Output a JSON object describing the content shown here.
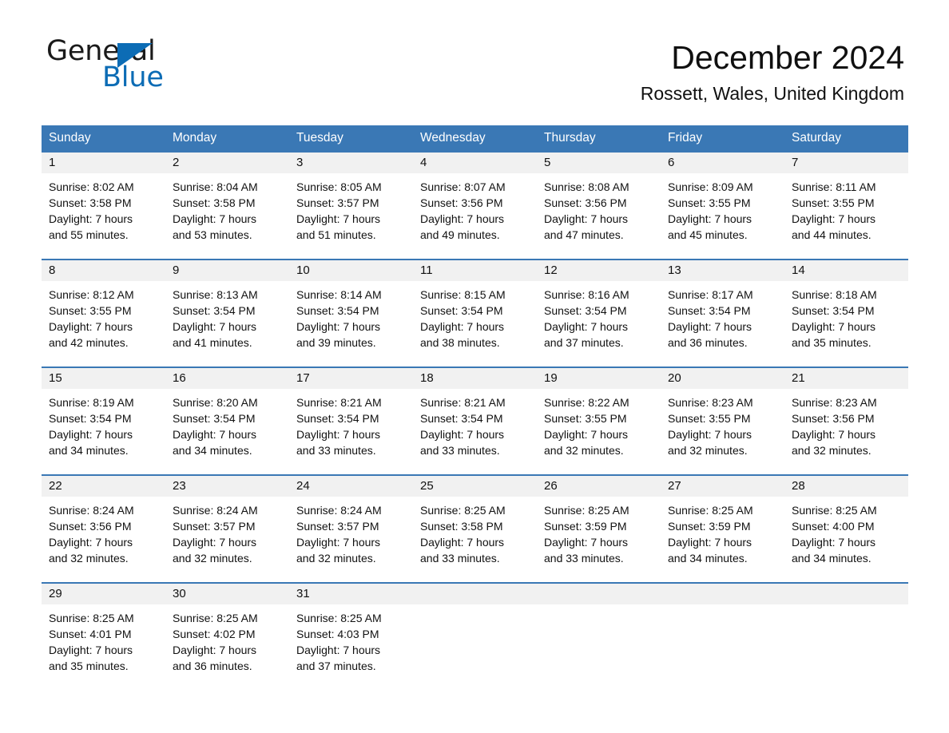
{
  "logo": {
    "word_one": "General",
    "word_two": "Blue",
    "triangle": "blue-triangle-icon",
    "accent_color": "#0c6cb5"
  },
  "header": {
    "month_title": "December 2024",
    "location": "Rossett, Wales, United Kingdom"
  },
  "theme": {
    "header_bar": "#3a78b5",
    "row_divider": "#3a78b5",
    "day_band": "#f1f1f1",
    "text": "#111111"
  },
  "weekdays": [
    "Sunday",
    "Monday",
    "Tuesday",
    "Wednesday",
    "Thursday",
    "Friday",
    "Saturday"
  ],
  "labels": {
    "sunrise_prefix": "Sunrise:",
    "sunset_prefix": "Sunset:",
    "daylight_prefix": "Daylight:"
  },
  "weeks": [
    [
      {
        "day": "1",
        "sunrise": "Sunrise: 8:02 AM",
        "sunset": "Sunset: 3:58 PM",
        "daylight_line1": "Daylight: 7 hours",
        "daylight_line2": "and 55 minutes."
      },
      {
        "day": "2",
        "sunrise": "Sunrise: 8:04 AM",
        "sunset": "Sunset: 3:58 PM",
        "daylight_line1": "Daylight: 7 hours",
        "daylight_line2": "and 53 minutes."
      },
      {
        "day": "3",
        "sunrise": "Sunrise: 8:05 AM",
        "sunset": "Sunset: 3:57 PM",
        "daylight_line1": "Daylight: 7 hours",
        "daylight_line2": "and 51 minutes."
      },
      {
        "day": "4",
        "sunrise": "Sunrise: 8:07 AM",
        "sunset": "Sunset: 3:56 PM",
        "daylight_line1": "Daylight: 7 hours",
        "daylight_line2": "and 49 minutes."
      },
      {
        "day": "5",
        "sunrise": "Sunrise: 8:08 AM",
        "sunset": "Sunset: 3:56 PM",
        "daylight_line1": "Daylight: 7 hours",
        "daylight_line2": "and 47 minutes."
      },
      {
        "day": "6",
        "sunrise": "Sunrise: 8:09 AM",
        "sunset": "Sunset: 3:55 PM",
        "daylight_line1": "Daylight: 7 hours",
        "daylight_line2": "and 45 minutes."
      },
      {
        "day": "7",
        "sunrise": "Sunrise: 8:11 AM",
        "sunset": "Sunset: 3:55 PM",
        "daylight_line1": "Daylight: 7 hours",
        "daylight_line2": "and 44 minutes."
      }
    ],
    [
      {
        "day": "8",
        "sunrise": "Sunrise: 8:12 AM",
        "sunset": "Sunset: 3:55 PM",
        "daylight_line1": "Daylight: 7 hours",
        "daylight_line2": "and 42 minutes."
      },
      {
        "day": "9",
        "sunrise": "Sunrise: 8:13 AM",
        "sunset": "Sunset: 3:54 PM",
        "daylight_line1": "Daylight: 7 hours",
        "daylight_line2": "and 41 minutes."
      },
      {
        "day": "10",
        "sunrise": "Sunrise: 8:14 AM",
        "sunset": "Sunset: 3:54 PM",
        "daylight_line1": "Daylight: 7 hours",
        "daylight_line2": "and 39 minutes."
      },
      {
        "day": "11",
        "sunrise": "Sunrise: 8:15 AM",
        "sunset": "Sunset: 3:54 PM",
        "daylight_line1": "Daylight: 7 hours",
        "daylight_line2": "and 38 minutes."
      },
      {
        "day": "12",
        "sunrise": "Sunrise: 8:16 AM",
        "sunset": "Sunset: 3:54 PM",
        "daylight_line1": "Daylight: 7 hours",
        "daylight_line2": "and 37 minutes."
      },
      {
        "day": "13",
        "sunrise": "Sunrise: 8:17 AM",
        "sunset": "Sunset: 3:54 PM",
        "daylight_line1": "Daylight: 7 hours",
        "daylight_line2": "and 36 minutes."
      },
      {
        "day": "14",
        "sunrise": "Sunrise: 8:18 AM",
        "sunset": "Sunset: 3:54 PM",
        "daylight_line1": "Daylight: 7 hours",
        "daylight_line2": "and 35 minutes."
      }
    ],
    [
      {
        "day": "15",
        "sunrise": "Sunrise: 8:19 AM",
        "sunset": "Sunset: 3:54 PM",
        "daylight_line1": "Daylight: 7 hours",
        "daylight_line2": "and 34 minutes."
      },
      {
        "day": "16",
        "sunrise": "Sunrise: 8:20 AM",
        "sunset": "Sunset: 3:54 PM",
        "daylight_line1": "Daylight: 7 hours",
        "daylight_line2": "and 34 minutes."
      },
      {
        "day": "17",
        "sunrise": "Sunrise: 8:21 AM",
        "sunset": "Sunset: 3:54 PM",
        "daylight_line1": "Daylight: 7 hours",
        "daylight_line2": "and 33 minutes."
      },
      {
        "day": "18",
        "sunrise": "Sunrise: 8:21 AM",
        "sunset": "Sunset: 3:54 PM",
        "daylight_line1": "Daylight: 7 hours",
        "daylight_line2": "and 33 minutes."
      },
      {
        "day": "19",
        "sunrise": "Sunrise: 8:22 AM",
        "sunset": "Sunset: 3:55 PM",
        "daylight_line1": "Daylight: 7 hours",
        "daylight_line2": "and 32 minutes."
      },
      {
        "day": "20",
        "sunrise": "Sunrise: 8:23 AM",
        "sunset": "Sunset: 3:55 PM",
        "daylight_line1": "Daylight: 7 hours",
        "daylight_line2": "and 32 minutes."
      },
      {
        "day": "21",
        "sunrise": "Sunrise: 8:23 AM",
        "sunset": "Sunset: 3:56 PM",
        "daylight_line1": "Daylight: 7 hours",
        "daylight_line2": "and 32 minutes."
      }
    ],
    [
      {
        "day": "22",
        "sunrise": "Sunrise: 8:24 AM",
        "sunset": "Sunset: 3:56 PM",
        "daylight_line1": "Daylight: 7 hours",
        "daylight_line2": "and 32 minutes."
      },
      {
        "day": "23",
        "sunrise": "Sunrise: 8:24 AM",
        "sunset": "Sunset: 3:57 PM",
        "daylight_line1": "Daylight: 7 hours",
        "daylight_line2": "and 32 minutes."
      },
      {
        "day": "24",
        "sunrise": "Sunrise: 8:24 AM",
        "sunset": "Sunset: 3:57 PM",
        "daylight_line1": "Daylight: 7 hours",
        "daylight_line2": "and 32 minutes."
      },
      {
        "day": "25",
        "sunrise": "Sunrise: 8:25 AM",
        "sunset": "Sunset: 3:58 PM",
        "daylight_line1": "Daylight: 7 hours",
        "daylight_line2": "and 33 minutes."
      },
      {
        "day": "26",
        "sunrise": "Sunrise: 8:25 AM",
        "sunset": "Sunset: 3:59 PM",
        "daylight_line1": "Daylight: 7 hours",
        "daylight_line2": "and 33 minutes."
      },
      {
        "day": "27",
        "sunrise": "Sunrise: 8:25 AM",
        "sunset": "Sunset: 3:59 PM",
        "daylight_line1": "Daylight: 7 hours",
        "daylight_line2": "and 34 minutes."
      },
      {
        "day": "28",
        "sunrise": "Sunrise: 8:25 AM",
        "sunset": "Sunset: 4:00 PM",
        "daylight_line1": "Daylight: 7 hours",
        "daylight_line2": "and 34 minutes."
      }
    ],
    [
      {
        "day": "29",
        "sunrise": "Sunrise: 8:25 AM",
        "sunset": "Sunset: 4:01 PM",
        "daylight_line1": "Daylight: 7 hours",
        "daylight_line2": "and 35 minutes."
      },
      {
        "day": "30",
        "sunrise": "Sunrise: 8:25 AM",
        "sunset": "Sunset: 4:02 PM",
        "daylight_line1": "Daylight: 7 hours",
        "daylight_line2": "and 36 minutes."
      },
      {
        "day": "31",
        "sunrise": "Sunrise: 8:25 AM",
        "sunset": "Sunset: 4:03 PM",
        "daylight_line1": "Daylight: 7 hours",
        "daylight_line2": "and 37 minutes."
      },
      {
        "day": "",
        "sunrise": "",
        "sunset": "",
        "daylight_line1": "",
        "daylight_line2": ""
      },
      {
        "day": "",
        "sunrise": "",
        "sunset": "",
        "daylight_line1": "",
        "daylight_line2": ""
      },
      {
        "day": "",
        "sunrise": "",
        "sunset": "",
        "daylight_line1": "",
        "daylight_line2": ""
      },
      {
        "day": "",
        "sunrise": "",
        "sunset": "",
        "daylight_line1": "",
        "daylight_line2": ""
      }
    ]
  ]
}
